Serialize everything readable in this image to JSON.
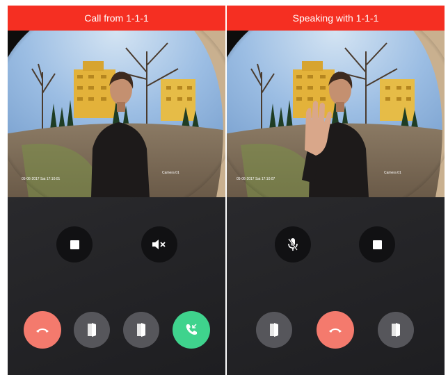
{
  "colors": {
    "title_bar": "#f52f22",
    "decline": "#f47a6d",
    "accept": "#3fd38d",
    "door": "#56565b"
  },
  "incoming": {
    "title": "Call from 1-1-1",
    "osd_timestamp": "05-06-2017 Sat 17:10:01",
    "osd_camera": "Camera 01",
    "controls": [
      "stop-icon",
      "mute-speaker-icon"
    ],
    "actions": [
      "decline-call-icon",
      "door-open-icon",
      "door-open-icon",
      "answer-call-icon"
    ]
  },
  "speaking": {
    "title": "Speaking with 1-1-1",
    "osd_timestamp": "05-06-2017 Sat 17:10:07",
    "osd_camera": "Camera 01",
    "controls": [
      "microphone-icon",
      "stop-icon"
    ],
    "actions": [
      "door-open-icon",
      "hang-up-icon",
      "door-open-icon"
    ]
  }
}
